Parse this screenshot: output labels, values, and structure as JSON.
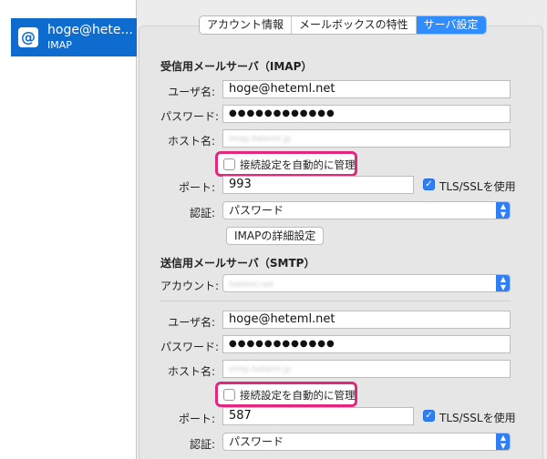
{
  "sidebar": {
    "account": {
      "icon": "@",
      "name": "hoge@hete...",
      "type": "IMAP"
    }
  },
  "tabs": [
    {
      "label": "アカウント情報"
    },
    {
      "label": "メールボックスの特性"
    },
    {
      "label": "サーバ設定"
    }
  ],
  "incoming": {
    "title": "受信用メールサーバ（IMAP）",
    "username_label": "ユーザ名:",
    "username": "hoge@heteml.net",
    "password_label": "パスワード:",
    "password": "●●●●●●●●●●●●",
    "host_label": "ホスト名:",
    "host": "imap.heteml.jp",
    "auto_manage_label": "接続設定を自動的に管理",
    "port_label": "ポート:",
    "port": "993",
    "tls_label": "TLS/SSLを使用",
    "auth_label": "認証:",
    "auth": "パスワード",
    "advanced_button": "IMAPの詳細設定"
  },
  "outgoing": {
    "title": "送信用メールサーバ（SMTP）",
    "account_label": "アカウント:",
    "account": "heteml.net",
    "username_label": "ユーザ名:",
    "username": "hoge@heteml.net",
    "password_label": "パスワード:",
    "password": "●●●●●●●●●●●●",
    "host_label": "ホスト名:",
    "host": "smtp.heteml.jp",
    "auto_manage_label": "接続設定を自動的に管理",
    "port_label": "ポート:",
    "port": "587",
    "tls_label": "TLS/SSLを使用",
    "auth_label": "認証:",
    "auth": "パスワード"
  },
  "colors": {
    "accent": "#2f8dff",
    "selection": "#0f6ccf",
    "highlight_frame": "#e0287e"
  }
}
